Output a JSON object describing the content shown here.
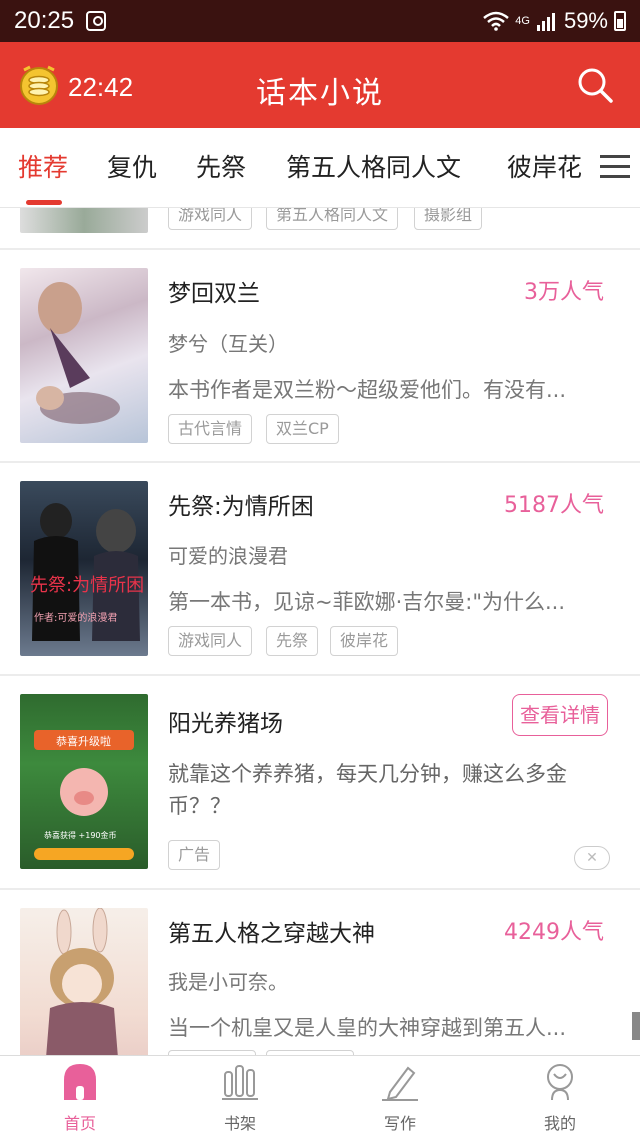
{
  "status_bar": {
    "time": "20:25",
    "network": "4G",
    "battery": "59%"
  },
  "app_bar": {
    "timer": "22:42",
    "title": "话本小说"
  },
  "tabs": [
    "推荐",
    "复仇",
    "先祭",
    "第五人格同人文",
    "彼岸花"
  ],
  "partial_item": {
    "tags": [
      "游戏同人",
      "第五人格同人文",
      "摄影组"
    ]
  },
  "books": [
    {
      "title": "梦回双兰",
      "popularity": "3万人气",
      "author": "梦兮（互关）",
      "description": "本书作者是双兰粉～超级爱他们。有没有...",
      "tags": [
        "古代言情",
        "双兰CP"
      ]
    },
    {
      "title": "先祭:为情所困",
      "popularity": "5187人气",
      "author": "可爱的浪漫君",
      "description": "第一本书，见谅~菲欧娜·吉尔曼:\"为什么...",
      "tags": [
        "游戏同人",
        "先祭",
        "彼岸花"
      ],
      "cover_text": "先祭:为情所困",
      "cover_subtext": "作者:可爱的浪漫君"
    },
    {
      "title": "第五人格之穿越大神",
      "popularity": "4249人气",
      "author": "我是小可奈。",
      "description": "当一个机皇又是人皇的大神穿越到第五人..."
    }
  ],
  "ad": {
    "title": "阳光养猪场",
    "detail_button": "查看详情",
    "description": "就靠这个养养猪，每天几分钟，赚这么多金币？？",
    "tag": "广告",
    "close": "✕",
    "cover_text": "恭喜升级啦",
    "cover_subtext": "恭喜获得 +190金币"
  },
  "bottom_nav": [
    {
      "label": "首页",
      "icon": "home-icon",
      "active": true
    },
    {
      "label": "书架",
      "icon": "bookshelf-icon",
      "active": false
    },
    {
      "label": "写作",
      "icon": "pen-icon",
      "active": false
    },
    {
      "label": "我的",
      "icon": "profile-icon",
      "active": false
    }
  ],
  "colors": {
    "brand_red": "#e43a30",
    "accent_pink": "#e8609a",
    "status_bar": "#3a1210"
  }
}
